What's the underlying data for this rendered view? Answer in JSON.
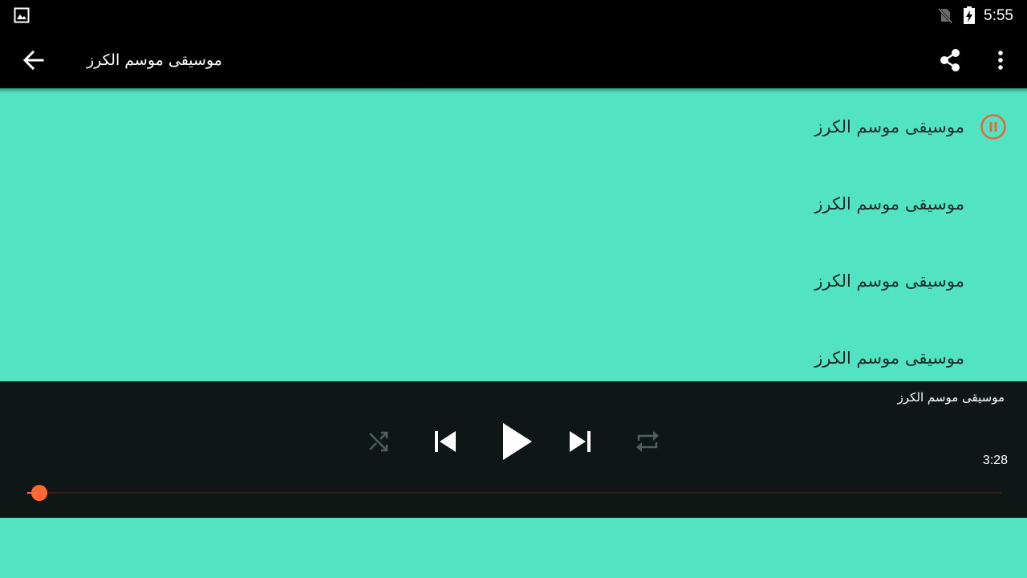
{
  "status_bar": {
    "time": "5:55",
    "icons": [
      "gallery-icon",
      "no-sim-icon",
      "battery-charging-icon"
    ]
  },
  "app_bar": {
    "title": "موسيقى موسم الكرز",
    "icons": [
      "back-arrow-icon",
      "share-icon",
      "more-vert-icon"
    ]
  },
  "tracks": [
    {
      "title": "موسيقى موسم الكرز",
      "state": "playing"
    },
    {
      "title": "موسيقى موسم الكرز"
    },
    {
      "title": "موسيقى موسم الكرز"
    },
    {
      "title": "موسيقى موسم الكرز"
    }
  ],
  "player": {
    "now_playing_title": "موسيقى موسم الكرز",
    "duration": "3:28",
    "progress_fraction": 0.012,
    "controls": [
      "shuffle-icon",
      "skip-previous-icon",
      "play-icon",
      "skip-next-icon",
      "repeat-icon"
    ]
  },
  "colors": {
    "background": "#52e3c2",
    "bars": "#000000",
    "player_background": "#0f1716",
    "accent": "#ff6a33",
    "pause_icon": "#e8663c"
  }
}
